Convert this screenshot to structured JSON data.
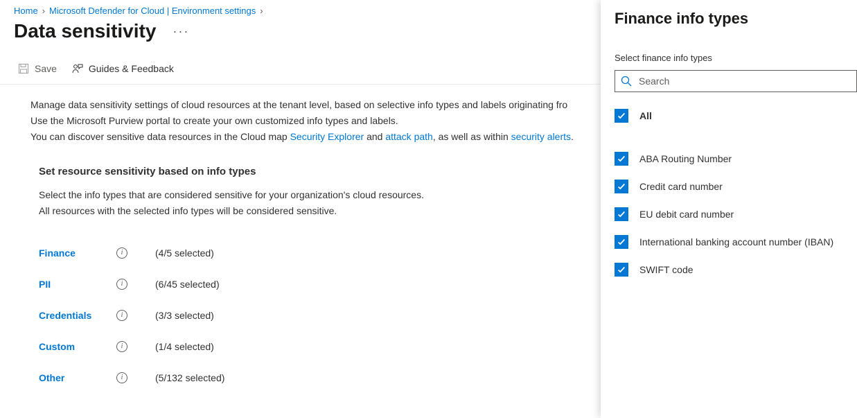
{
  "breadcrumb": {
    "home": "Home",
    "env": "Microsoft Defender for Cloud | Environment settings"
  },
  "page_title": "Data sensitivity",
  "toolbar": {
    "save": "Save",
    "guides": "Guides & Feedback"
  },
  "description": {
    "line1_a": "Manage data sensitivity settings of cloud resources at the tenant level, based on selective info types and labels originating fro",
    "line2": "Use the Microsoft Purview portal to create your own customized info types and labels.",
    "line3_a": "You can discover sensitive data resources in the Cloud map ",
    "line3_link1": "Security Explorer",
    "line3_b": " and ",
    "line3_link2": "attack path",
    "line3_c": ", as well as within ",
    "line3_link3": "security alerts",
    "line3_d": "."
  },
  "section": {
    "title": "Set resource sensitivity based on info types",
    "sub1": "Select the info types that are considered sensitive for your organization's cloud resources.",
    "sub2": "All resources with the selected info types will be considered sensitive."
  },
  "categories": [
    {
      "name": "Finance",
      "count": "(4/5 selected)"
    },
    {
      "name": "PII",
      "count": "(6/45 selected)"
    },
    {
      "name": "Credentials",
      "count": "(3/3 selected)"
    },
    {
      "name": "Custom",
      "count": "(1/4 selected)"
    },
    {
      "name": "Other",
      "count": "(5/132 selected)"
    }
  ],
  "panel": {
    "title": "Finance info types",
    "subtitle": "Select finance info types",
    "search_placeholder": "Search",
    "all_label": "All",
    "items": [
      "ABA Routing Number",
      "Credit card number",
      "EU debit card number",
      "International banking account number (IBAN)",
      "SWIFT code"
    ]
  }
}
